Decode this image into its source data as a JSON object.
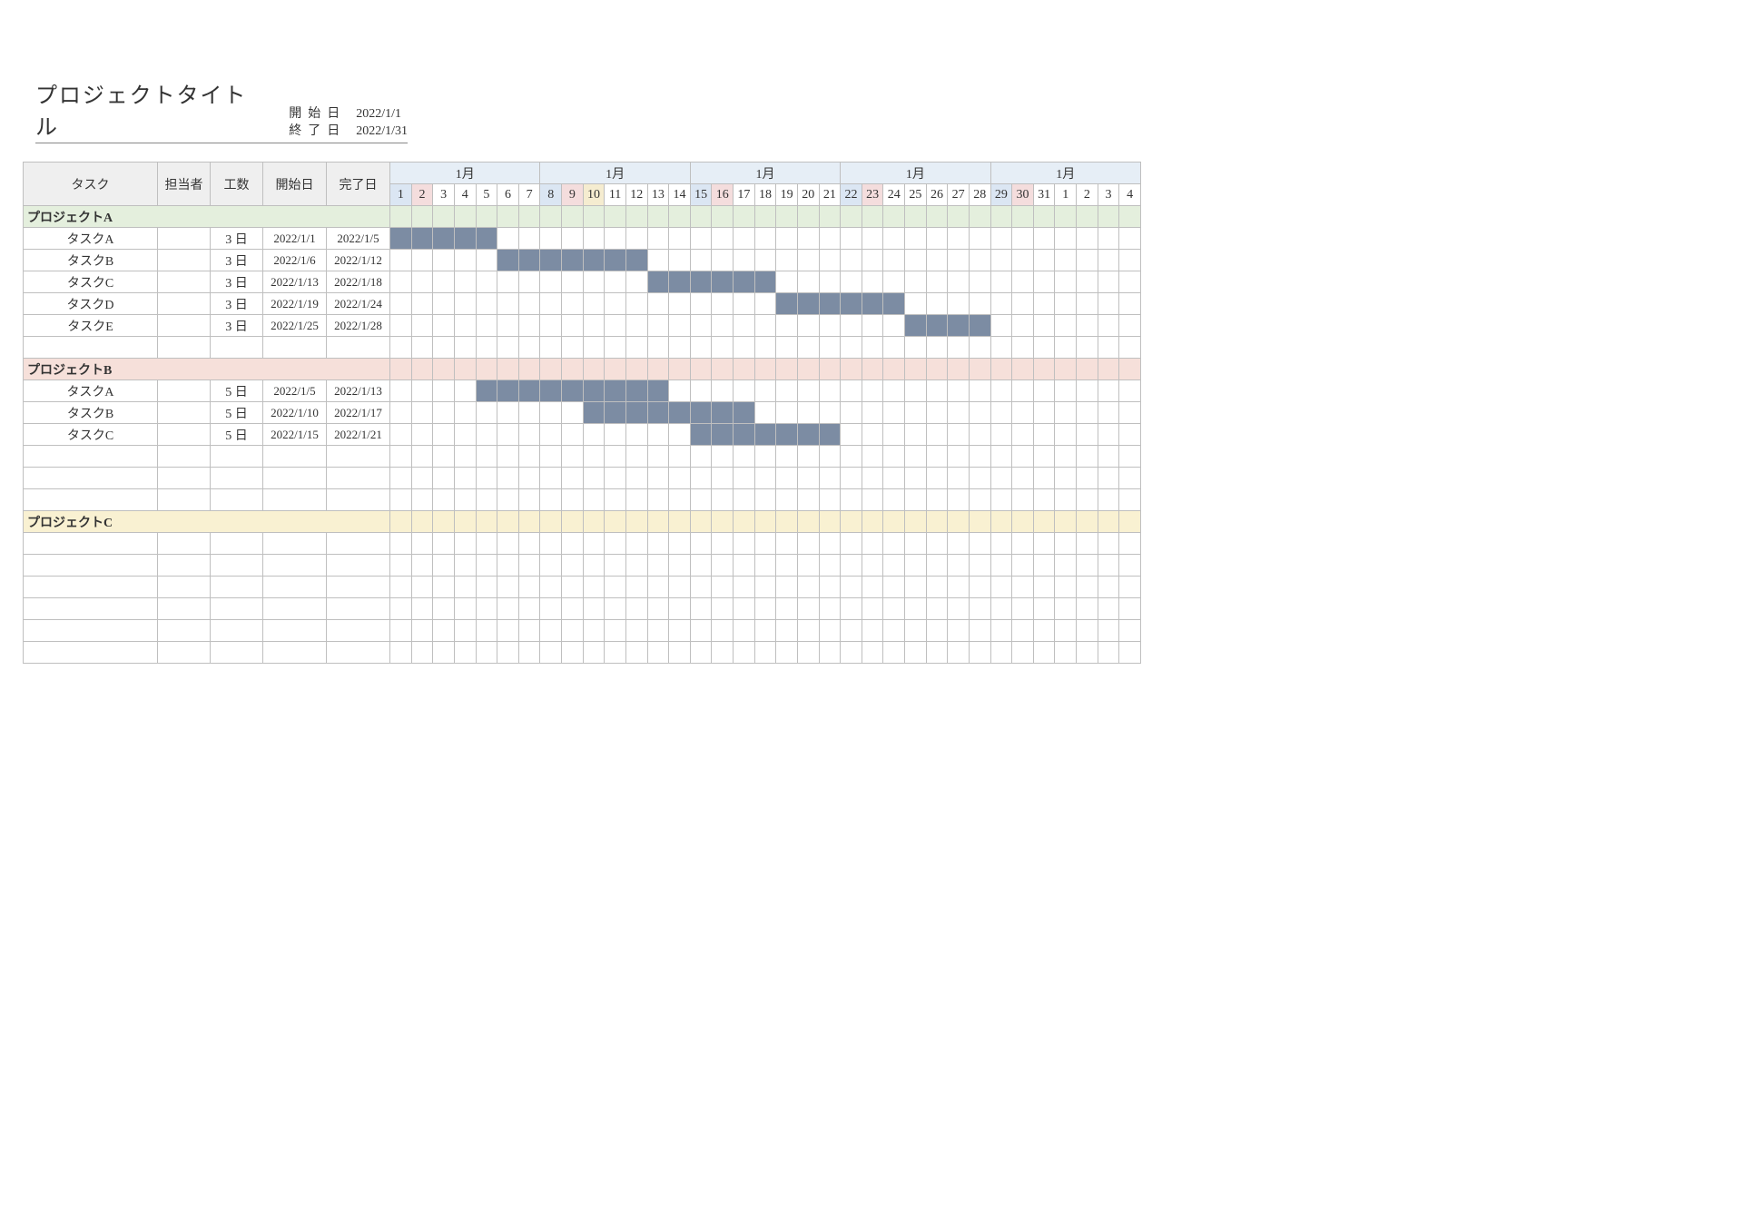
{
  "title": "プロジェクトタイトル",
  "meta": {
    "start_label": "開始日",
    "start_value": "2022/1/1",
    "end_label": "終了日",
    "end_value": "2022/1/31"
  },
  "columns": {
    "task": "タスク",
    "assignee": "担当者",
    "effort": "工数",
    "start": "開始日",
    "end": "完了日"
  },
  "month_label": "1月",
  "effort_unit": "日",
  "chart_data": {
    "type": "gantt",
    "calendar": {
      "start": "2022/1/1",
      "end": "2022/2/4",
      "month_groups": [
        7,
        7,
        7,
        7,
        7
      ],
      "days": [
        1,
        2,
        3,
        4,
        5,
        6,
        7,
        8,
        9,
        10,
        11,
        12,
        13,
        14,
        15,
        16,
        17,
        18,
        19,
        20,
        21,
        22,
        23,
        24,
        25,
        26,
        27,
        28,
        29,
        30,
        31,
        1,
        2,
        3,
        4
      ],
      "highlight": {
        "sat": [
          1,
          8,
          15,
          22,
          29
        ],
        "sun": [
          2,
          9,
          16,
          23,
          30
        ],
        "holiday": [
          10
        ]
      }
    },
    "groups": [
      {
        "name": "プロジェクトA",
        "class": "pA",
        "tasks": [
          {
            "name": "タスクA",
            "assignee": "",
            "effort": 3,
            "start": "2022/1/1",
            "end": "2022/1/5",
            "bar": [
              1,
              5
            ]
          },
          {
            "name": "タスクB",
            "assignee": "",
            "effort": 3,
            "start": "2022/1/6",
            "end": "2022/1/12",
            "bar": [
              6,
              12
            ]
          },
          {
            "name": "タスクC",
            "assignee": "",
            "effort": 3,
            "start": "2022/1/13",
            "end": "2022/1/18",
            "bar": [
              13,
              18
            ]
          },
          {
            "name": "タスクD",
            "assignee": "",
            "effort": 3,
            "start": "2022/1/19",
            "end": "2022/1/24",
            "bar": [
              19,
              24
            ]
          },
          {
            "name": "タスクE",
            "assignee": "",
            "effort": 3,
            "start": "2022/1/25",
            "end": "2022/1/28",
            "bar": [
              25,
              28
            ]
          }
        ],
        "blank_rows_after": 1
      },
      {
        "name": "プロジェクトB",
        "class": "pB",
        "tasks": [
          {
            "name": "タスクA",
            "assignee": "",
            "effort": 5,
            "start": "2022/1/5",
            "end": "2022/1/13",
            "bar": [
              5,
              13
            ]
          },
          {
            "name": "タスクB",
            "assignee": "",
            "effort": 5,
            "start": "2022/1/10",
            "end": "2022/1/17",
            "bar": [
              10,
              17
            ]
          },
          {
            "name": "タスクC",
            "assignee": "",
            "effort": 5,
            "start": "2022/1/15",
            "end": "2022/1/21",
            "bar": [
              15,
              21
            ]
          }
        ],
        "blank_rows_after": 3
      },
      {
        "name": "プロジェクトC",
        "class": "pC",
        "tasks": [],
        "blank_rows_after": 6
      }
    ]
  }
}
